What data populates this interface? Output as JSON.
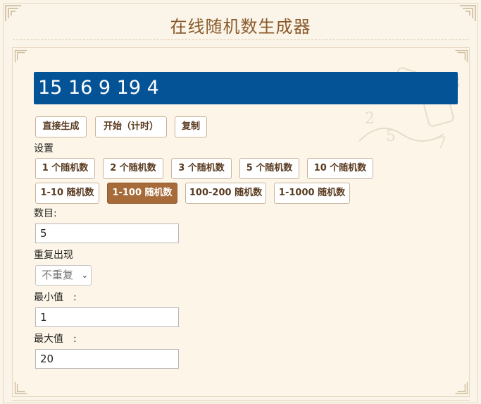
{
  "header": {
    "title": "在线随机数生成器"
  },
  "display": {
    "numbers": "15 16 9 19 4"
  },
  "actions": [
    {
      "label": "直接生成"
    },
    {
      "label": "开始（计时）"
    },
    {
      "label": "复制"
    }
  ],
  "settings": {
    "heading": "设置",
    "count_presets": [
      "1 个随机数",
      "2 个随机数",
      "3 个随机数",
      "5 个随机数",
      "10 个随机数"
    ],
    "range_presets": [
      "1-10 随机数",
      "1-100 随机数",
      "100-200 随机数",
      "1-1000 随机数"
    ],
    "active_range": "1-100 随机数"
  },
  "form": {
    "count_label": "数目:",
    "count_value": "5",
    "repeat_label": "重复出现",
    "repeat_value": "不重复",
    "min_label": "最小值　:",
    "min_value": "1",
    "max_label": "最大值　:",
    "max_value": "20"
  },
  "colors": {
    "display_bg": "#055397",
    "accent": "#a76b39",
    "title": "#8a5a2b",
    "page_bg": "#fbf5e9"
  }
}
